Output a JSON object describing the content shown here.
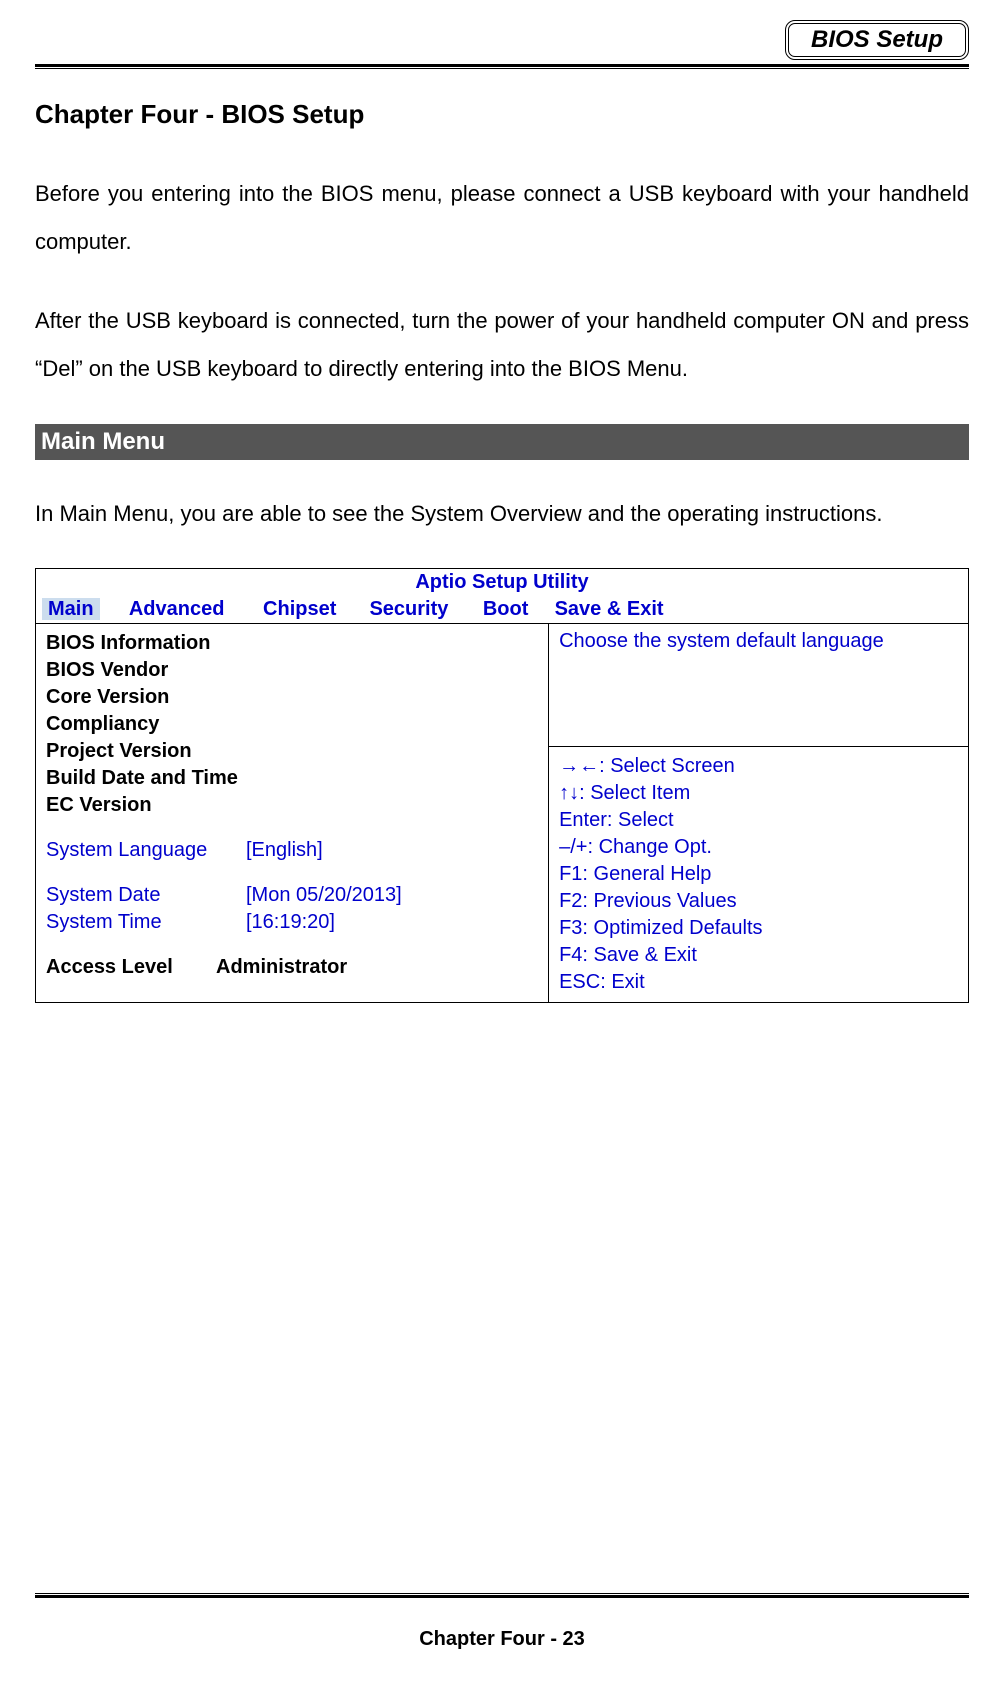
{
  "header": {
    "badge": "BIOS Setup"
  },
  "chapter": {
    "title": "Chapter Four - BIOS Setup",
    "para1": "Before you entering into the BIOS menu, please connect a USB keyboard with your handheld computer.",
    "para2": "After the USB keyboard is connected, turn the power of your handheld computer ON and press “Del” on the USB keyboard to directly entering into the BIOS Menu."
  },
  "section": {
    "title": " Main Menu",
    "intro": "In Main Menu, you are able to see the System Overview and the operating instructions."
  },
  "bios": {
    "utility_title": "Aptio Setup Utility",
    "tabs": {
      "main": "Main",
      "advanced": "Advanced",
      "chipset": "Chipset",
      "security": "Security",
      "boot": "Boot",
      "save_exit": "Save & Exit"
    },
    "left": {
      "heading": "BIOS Information",
      "rows": [
        "BIOS Vendor",
        "Core Version",
        "Compliancy",
        "Project Version",
        "Build Date and Time",
        "EC Version"
      ],
      "system_language_label": "System Language",
      "system_language_value": "[English]",
      "system_date_label": "System Date",
      "system_date_value": "[Mon 05/20/2013]",
      "system_time_label": "System Time",
      "system_time_value": "[16:19:20]",
      "access_level_label": "Access Level",
      "access_level_value": "Administrator"
    },
    "right": {
      "help_text": "Choose the system default language",
      "keys": [
        "→←: Select Screen",
        "↑↓: Select Item",
        "Enter: Select",
        "–/+: Change Opt.",
        "F1: General Help",
        "F2: Previous Values",
        "F3: Optimized Defaults",
        "F4: Save & Exit",
        "ESC: Exit"
      ]
    }
  },
  "footer": {
    "text": "Chapter Four - 23"
  }
}
